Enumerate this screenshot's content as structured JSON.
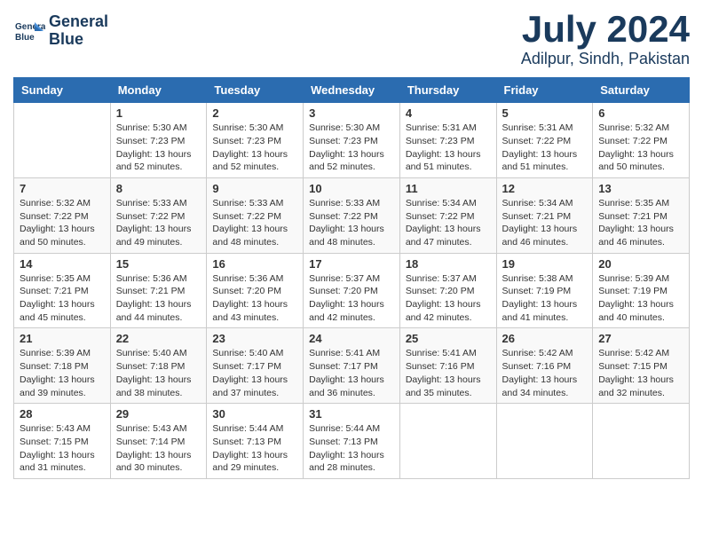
{
  "header": {
    "logo_line1": "General",
    "logo_line2": "Blue",
    "month_year": "July 2024",
    "location": "Adilpur, Sindh, Pakistan"
  },
  "weekdays": [
    "Sunday",
    "Monday",
    "Tuesday",
    "Wednesday",
    "Thursday",
    "Friday",
    "Saturday"
  ],
  "weeks": [
    [
      {
        "day": null
      },
      {
        "day": "1",
        "sunrise": "5:30 AM",
        "sunset": "7:23 PM",
        "daylight": "13 hours and 52 minutes."
      },
      {
        "day": "2",
        "sunrise": "5:30 AM",
        "sunset": "7:23 PM",
        "daylight": "13 hours and 52 minutes."
      },
      {
        "day": "3",
        "sunrise": "5:30 AM",
        "sunset": "7:23 PM",
        "daylight": "13 hours and 52 minutes."
      },
      {
        "day": "4",
        "sunrise": "5:31 AM",
        "sunset": "7:23 PM",
        "daylight": "13 hours and 51 minutes."
      },
      {
        "day": "5",
        "sunrise": "5:31 AM",
        "sunset": "7:22 PM",
        "daylight": "13 hours and 51 minutes."
      },
      {
        "day": "6",
        "sunrise": "5:32 AM",
        "sunset": "7:22 PM",
        "daylight": "13 hours and 50 minutes."
      }
    ],
    [
      {
        "day": "7",
        "sunrise": "5:32 AM",
        "sunset": "7:22 PM",
        "daylight": "13 hours and 50 minutes."
      },
      {
        "day": "8",
        "sunrise": "5:33 AM",
        "sunset": "7:22 PM",
        "daylight": "13 hours and 49 minutes."
      },
      {
        "day": "9",
        "sunrise": "5:33 AM",
        "sunset": "7:22 PM",
        "daylight": "13 hours and 48 minutes."
      },
      {
        "day": "10",
        "sunrise": "5:33 AM",
        "sunset": "7:22 PM",
        "daylight": "13 hours and 48 minutes."
      },
      {
        "day": "11",
        "sunrise": "5:34 AM",
        "sunset": "7:22 PM",
        "daylight": "13 hours and 47 minutes."
      },
      {
        "day": "12",
        "sunrise": "5:34 AM",
        "sunset": "7:21 PM",
        "daylight": "13 hours and 46 minutes."
      },
      {
        "day": "13",
        "sunrise": "5:35 AM",
        "sunset": "7:21 PM",
        "daylight": "13 hours and 46 minutes."
      }
    ],
    [
      {
        "day": "14",
        "sunrise": "5:35 AM",
        "sunset": "7:21 PM",
        "daylight": "13 hours and 45 minutes."
      },
      {
        "day": "15",
        "sunrise": "5:36 AM",
        "sunset": "7:21 PM",
        "daylight": "13 hours and 44 minutes."
      },
      {
        "day": "16",
        "sunrise": "5:36 AM",
        "sunset": "7:20 PM",
        "daylight": "13 hours and 43 minutes."
      },
      {
        "day": "17",
        "sunrise": "5:37 AM",
        "sunset": "7:20 PM",
        "daylight": "13 hours and 42 minutes."
      },
      {
        "day": "18",
        "sunrise": "5:37 AM",
        "sunset": "7:20 PM",
        "daylight": "13 hours and 42 minutes."
      },
      {
        "day": "19",
        "sunrise": "5:38 AM",
        "sunset": "7:19 PM",
        "daylight": "13 hours and 41 minutes."
      },
      {
        "day": "20",
        "sunrise": "5:39 AM",
        "sunset": "7:19 PM",
        "daylight": "13 hours and 40 minutes."
      }
    ],
    [
      {
        "day": "21",
        "sunrise": "5:39 AM",
        "sunset": "7:18 PM",
        "daylight": "13 hours and 39 minutes."
      },
      {
        "day": "22",
        "sunrise": "5:40 AM",
        "sunset": "7:18 PM",
        "daylight": "13 hours and 38 minutes."
      },
      {
        "day": "23",
        "sunrise": "5:40 AM",
        "sunset": "7:17 PM",
        "daylight": "13 hours and 37 minutes."
      },
      {
        "day": "24",
        "sunrise": "5:41 AM",
        "sunset": "7:17 PM",
        "daylight": "13 hours and 36 minutes."
      },
      {
        "day": "25",
        "sunrise": "5:41 AM",
        "sunset": "7:16 PM",
        "daylight": "13 hours and 35 minutes."
      },
      {
        "day": "26",
        "sunrise": "5:42 AM",
        "sunset": "7:16 PM",
        "daylight": "13 hours and 34 minutes."
      },
      {
        "day": "27",
        "sunrise": "5:42 AM",
        "sunset": "7:15 PM",
        "daylight": "13 hours and 32 minutes."
      }
    ],
    [
      {
        "day": "28",
        "sunrise": "5:43 AM",
        "sunset": "7:15 PM",
        "daylight": "13 hours and 31 minutes."
      },
      {
        "day": "29",
        "sunrise": "5:43 AM",
        "sunset": "7:14 PM",
        "daylight": "13 hours and 30 minutes."
      },
      {
        "day": "30",
        "sunrise": "5:44 AM",
        "sunset": "7:13 PM",
        "daylight": "13 hours and 29 minutes."
      },
      {
        "day": "31",
        "sunrise": "5:44 AM",
        "sunset": "7:13 PM",
        "daylight": "13 hours and 28 minutes."
      },
      {
        "day": null
      },
      {
        "day": null
      },
      {
        "day": null
      }
    ]
  ]
}
